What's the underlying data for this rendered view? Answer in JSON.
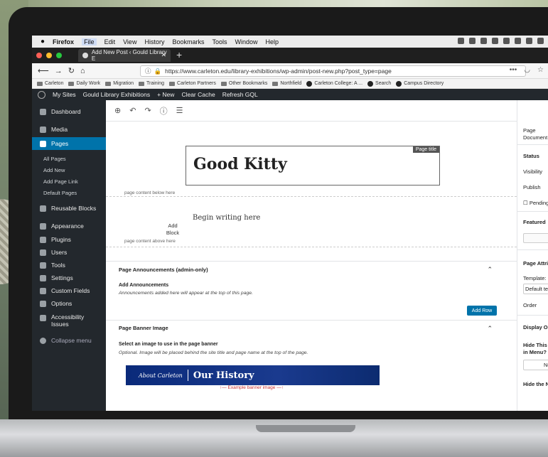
{
  "mac_menu": {
    "apple": "",
    "app": "Firefox",
    "items": [
      "File",
      "Edit",
      "View",
      "History",
      "Bookmarks",
      "Tools",
      "Window",
      "Help"
    ]
  },
  "browser": {
    "tab_title": "Add New Post ‹ Gould Library E",
    "url": "https://www.carleton.edu/library-exhibitions/wp-admin/post-new.php?post_type=page",
    "bookmarks": [
      "Carleton",
      "Daily Work",
      "Migration",
      "Training",
      "Carleton Partners",
      "Other Bookmarks",
      "Northfield",
      "Carleton College: A ...",
      "Search",
      "Campus Directory"
    ]
  },
  "adminbar": {
    "my_sites": "My Sites",
    "site": "Gould Library Exhibitions",
    "new": "+ New",
    "clear_cache": "Clear Cache",
    "refresh": "Refresh GQL"
  },
  "sidebar": {
    "dashboard": "Dashboard",
    "media": "Media",
    "pages": "Pages",
    "pages_sub": [
      "All Pages",
      "Add New",
      "Add Page Link",
      "Default Pages"
    ],
    "reusable": "Reusable Blocks",
    "appearance": "Appearance",
    "plugins": "Plugins",
    "users": "Users",
    "tools": "Tools",
    "settings": "Settings",
    "custom_fields": "Custom Fields",
    "options": "Options",
    "accessibility": "Accessibility Issues",
    "collapse": "Collapse menu"
  },
  "editor": {
    "page_title_label": "Page title",
    "title": "Good Kitty",
    "below_label": "page content below here",
    "begin": "Begin writing here",
    "add_block": "Add Block",
    "above_label": "page content above here",
    "announcements_title": "Page Announcements (admin-only)",
    "add_announcements": "Add Announcements",
    "announcements_help": "Announcements added here will appear at the top of this page.",
    "add_row": "Add Row",
    "banner_title": "Page Banner Image",
    "banner_select": "Select an image to use in the page banner",
    "banner_help": "Optional. Image will be placed behind the site title and page name at the top of the page.",
    "banner_small": "About Carleton",
    "banner_big": "Our History",
    "banner_caption": "↑— Example banner image —↑"
  },
  "settings_panel": {
    "tab_line1": "Page",
    "tab_line2": "Document",
    "status": "Status",
    "visibility": "Visibility",
    "publish": "Publish",
    "pending": "Pending",
    "featured": "Featured",
    "page_attributes": "Page Attributes",
    "template": "Template:",
    "template_value": "Default template",
    "order": "Order",
    "display_options": "Display Options",
    "hide_this_page": "Hide This Page in Menu?",
    "no": "No",
    "hide_navigation": "Hide the Navigation"
  }
}
